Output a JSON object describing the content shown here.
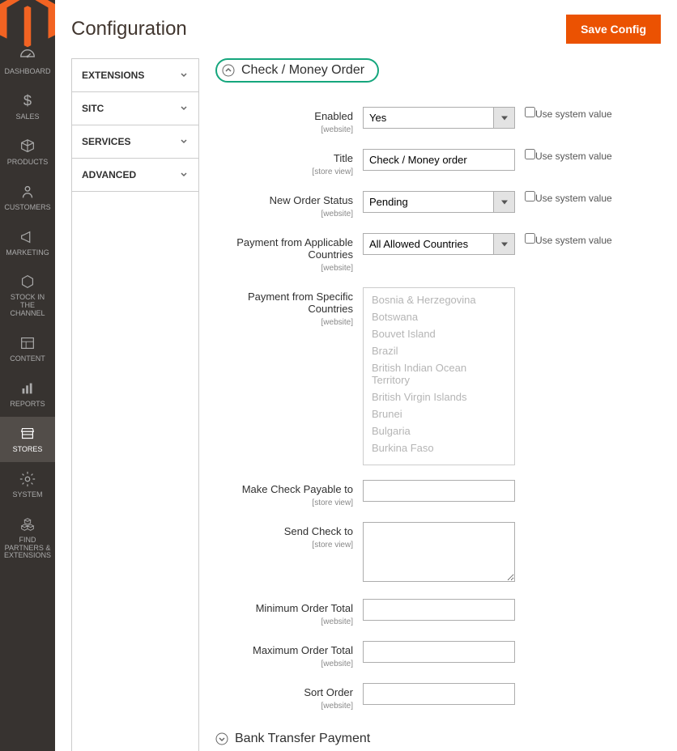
{
  "page_title": "Configuration",
  "save_button": "Save Config",
  "nav": [
    {
      "label": "DASHBOARD",
      "icon": "dashboard"
    },
    {
      "label": "SALES",
      "icon": "dollar"
    },
    {
      "label": "PRODUCTS",
      "icon": "cube"
    },
    {
      "label": "CUSTOMERS",
      "icon": "person"
    },
    {
      "label": "MARKETING",
      "icon": "megaphone"
    },
    {
      "label": "STOCK IN THE CHANNEL",
      "icon": "hex"
    },
    {
      "label": "CONTENT",
      "icon": "layout"
    },
    {
      "label": "REPORTS",
      "icon": "bars"
    },
    {
      "label": "STORES",
      "icon": "store",
      "active": true
    },
    {
      "label": "SYSTEM",
      "icon": "gear"
    },
    {
      "label": "FIND PARTNERS & EXTENSIONS",
      "icon": "cubes"
    }
  ],
  "accordion": [
    "EXTENSIONS",
    "SITC",
    "SERVICES",
    "ADVANCED"
  ],
  "section": {
    "title": "Check / Money Order",
    "fields": {
      "enabled": {
        "label": "Enabled",
        "scope": "[website]",
        "value": "Yes",
        "sys_label": "Use system value"
      },
      "title": {
        "label": "Title",
        "scope": "[store view]",
        "value": "Check / Money order",
        "sys_label": "Use system value"
      },
      "new_order_status": {
        "label": "New Order Status",
        "scope": "[website]",
        "value": "Pending",
        "sys_label": "Use system value"
      },
      "applicable_countries": {
        "label": "Payment from Applicable Countries",
        "scope": "[website]",
        "value": "All Allowed Countries",
        "sys_label": "Use system value"
      },
      "specific_countries": {
        "label": "Payment from Specific Countries",
        "scope": "[website]",
        "options": [
          "Bosnia & Herzegovina",
          "Botswana",
          "Bouvet Island",
          "Brazil",
          "British Indian Ocean Territory",
          "British Virgin Islands",
          "Brunei",
          "Bulgaria",
          "Burkina Faso"
        ]
      },
      "payable_to": {
        "label": "Make Check Payable to",
        "scope": "[store view]",
        "value": ""
      },
      "send_to": {
        "label": "Send Check to",
        "scope": "[store view]",
        "value": ""
      },
      "min_total": {
        "label": "Minimum Order Total",
        "scope": "[website]",
        "value": ""
      },
      "max_total": {
        "label": "Maximum Order Total",
        "scope": "[website]",
        "value": ""
      },
      "sort_order": {
        "label": "Sort Order",
        "scope": "[website]",
        "value": ""
      }
    }
  },
  "section2_title": "Bank Transfer Payment"
}
